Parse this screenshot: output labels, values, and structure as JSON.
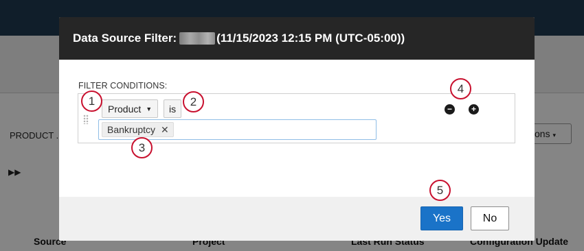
{
  "background": {
    "product_label": "PRODUCT ...",
    "actions_button": "tions",
    "expand_icon": "double-chevron-right-icon",
    "columns": [
      "Source",
      "Project",
      "Last Run Status",
      "Configuration Update"
    ]
  },
  "dialog": {
    "title_prefix": "Data Source Filter:",
    "title_timestamp": "(11/15/2023 12:15 PM (UTC-05:00))",
    "filter_conditions_label": "FILTER CONDITIONS:",
    "condition": {
      "field": "Product",
      "operator": "is",
      "values": [
        "Bankruptcy"
      ]
    },
    "remove_condition_icon": "minus-circle-icon",
    "add_condition_icon": "plus-circle-icon",
    "yes_label": "Yes",
    "no_label": "No"
  },
  "callouts": [
    "1",
    "2",
    "3",
    "4",
    "5"
  ],
  "colors": {
    "header_bg": "#262626",
    "primary_button": "#1a73c8",
    "callout_ring": "#c8102e"
  }
}
